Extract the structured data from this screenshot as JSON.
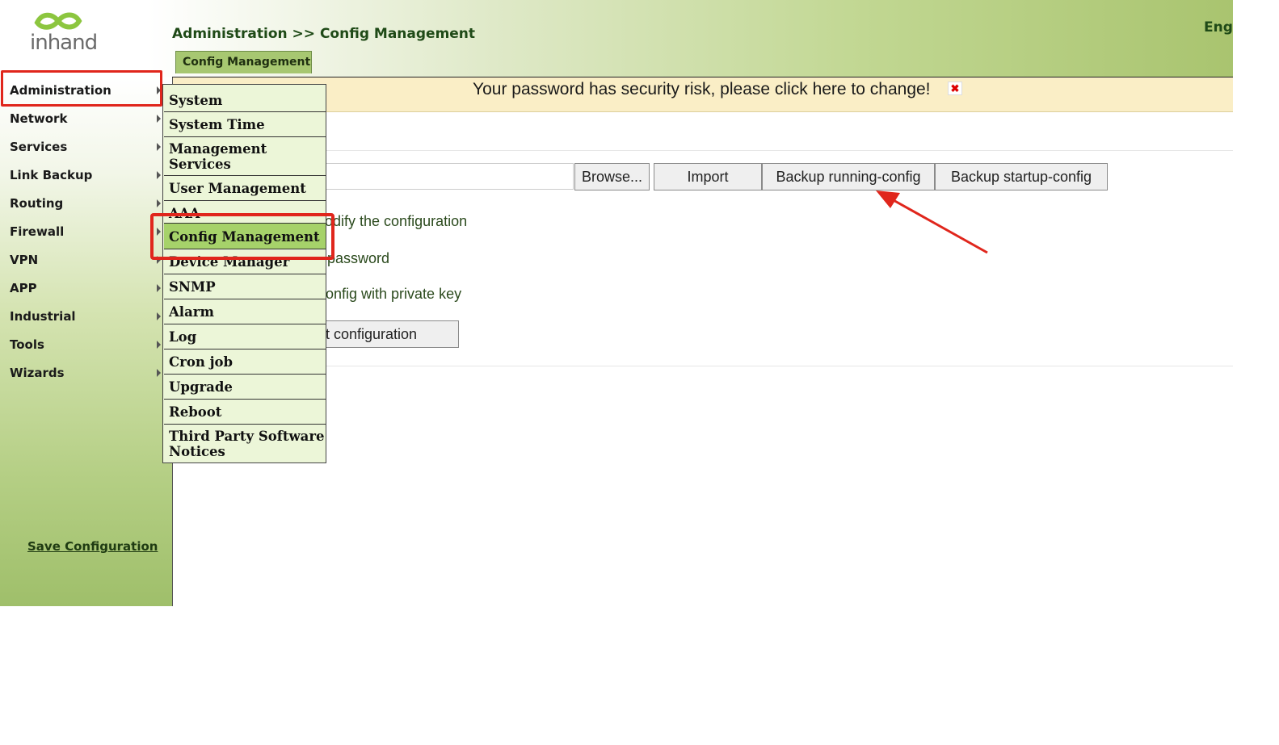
{
  "header": {
    "breadcrumb": "Administration >> Config Management",
    "language": "Eng",
    "tab_label": "Config Management",
    "logo_text": "inhand"
  },
  "warning": {
    "text": "Your password has security risk, please click here to change!",
    "close_glyph": "✖"
  },
  "sidebar": {
    "items": [
      {
        "label": "Administration"
      },
      {
        "label": "Network"
      },
      {
        "label": "Services"
      },
      {
        "label": "Link Backup"
      },
      {
        "label": "Routing"
      },
      {
        "label": "Firewall"
      },
      {
        "label": "VPN"
      },
      {
        "label": "APP"
      },
      {
        "label": "Industrial"
      },
      {
        "label": "Tools"
      },
      {
        "label": "Wizards"
      }
    ],
    "save_label": "Save Configuration"
  },
  "submenu": {
    "items": [
      {
        "label": "System"
      },
      {
        "label": "System Time"
      },
      {
        "label": "Management Services"
      },
      {
        "label": "User Management"
      },
      {
        "label": "AAA"
      },
      {
        "label": "Config Management"
      },
      {
        "label": "Device Manager"
      },
      {
        "label": "SNMP"
      },
      {
        "label": "Alarm"
      },
      {
        "label": "Log"
      },
      {
        "label": "Cron job"
      },
      {
        "label": "Upgrade"
      },
      {
        "label": "Reboot"
      },
      {
        "label": "Third Party Software Notices"
      }
    ],
    "active": "Config Management"
  },
  "content": {
    "buttons": {
      "browse": "Browse...",
      "import": "Import",
      "backup_running": "Backup running-config",
      "backup_startup": "Backup startup-config"
    },
    "options": {
      "modify": "odify the configuration",
      "password": "password",
      "private_key": "onfig with private key"
    },
    "restore_button": "t configuration"
  },
  "colors": {
    "annotation_red": "#e0261c",
    "menu_active": "#a6d26a",
    "sidebar_green": "#9fbf6a"
  },
  "icons": {
    "logo": "inhand-logo-icon",
    "close": "close-icon",
    "submenu_arrow": "chevron-right-icon",
    "annotation_arrow": "red-arrow-icon"
  }
}
